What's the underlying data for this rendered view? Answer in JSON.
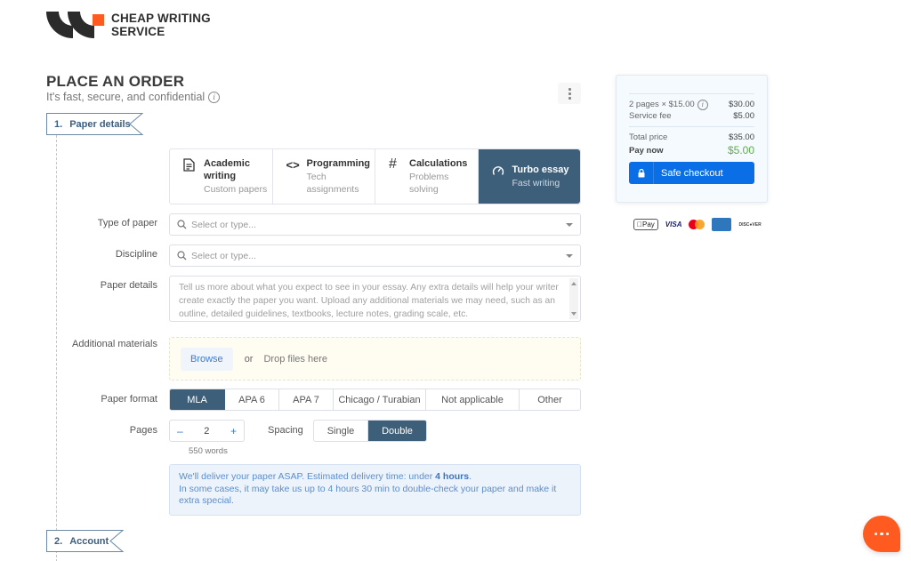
{
  "brand": {
    "name_line1": "CHEAP WRITING",
    "name_line2": "SERVICE",
    "accent_color": "#ff5a1f"
  },
  "header": {
    "title": "PLACE AN ORDER",
    "subtitle": "It's fast, secure, and confidential"
  },
  "steps": [
    {
      "number": "1.",
      "label": "Paper details"
    },
    {
      "number": "2.",
      "label": "Account"
    }
  ],
  "service_tiles": [
    {
      "icon": "document-icon",
      "title": "Academic writing",
      "subtitle": "Custom papers",
      "active": false
    },
    {
      "icon": "code-icon",
      "title": "Programming",
      "subtitle": "Tech assignments",
      "active": false
    },
    {
      "icon": "hash-icon",
      "title": "Calculations",
      "subtitle": "Problems solving",
      "active": false
    },
    {
      "icon": "speedometer-icon",
      "title": "Turbo essay",
      "subtitle": "Fast writing",
      "active": true
    }
  ],
  "form": {
    "type_of_paper": {
      "label": "Type of paper",
      "placeholder": "Select or type..."
    },
    "discipline": {
      "label": "Discipline",
      "placeholder": "Select or type..."
    },
    "paper_details": {
      "label": "Paper details",
      "placeholder": "Tell us more about what you expect to see in your essay. Any extra details will help your writer create exactly the paper you want. Upload any additional materials we may need, such as an outline, detailed guidelines, textbooks, lecture notes, grading scale, etc."
    },
    "additional_materials": {
      "label": "Additional materials",
      "browse": "Browse",
      "or": "or",
      "drop": "Drop files here"
    },
    "paper_format": {
      "label": "Paper format",
      "options": [
        "MLA",
        "APA 6",
        "APA 7",
        "Chicago / Turabian",
        "Not applicable",
        "Other"
      ],
      "selected": "MLA"
    },
    "pages": {
      "label": "Pages",
      "value": "2",
      "minus": "–",
      "plus": "+",
      "words": "550 words"
    },
    "spacing": {
      "label": "Spacing",
      "options": [
        "Single",
        "Double"
      ],
      "selected": "Double"
    },
    "notice": {
      "line1_pre": "We'll deliver your paper ASAP. Estimated delivery time: under ",
      "line1_bold": "4 hours",
      "line1_post": ".",
      "line2": "In some cases, it may take us up to 4 hours 30 min to double-check your paper and make it extra special."
    }
  },
  "summary": {
    "pages_line": "2 pages × $15.00",
    "pages_price": "$30.00",
    "service_fee_label": "Service fee",
    "service_fee": "$5.00",
    "total_label": "Total price",
    "total": "$35.00",
    "pay_now_label": "Pay now",
    "pay_now": "$5.00",
    "checkout_label": "Safe checkout"
  },
  "payment_methods": [
    "Apple Pay",
    "VISA",
    "Mastercard",
    "American Express",
    "DISCOVER"
  ]
}
